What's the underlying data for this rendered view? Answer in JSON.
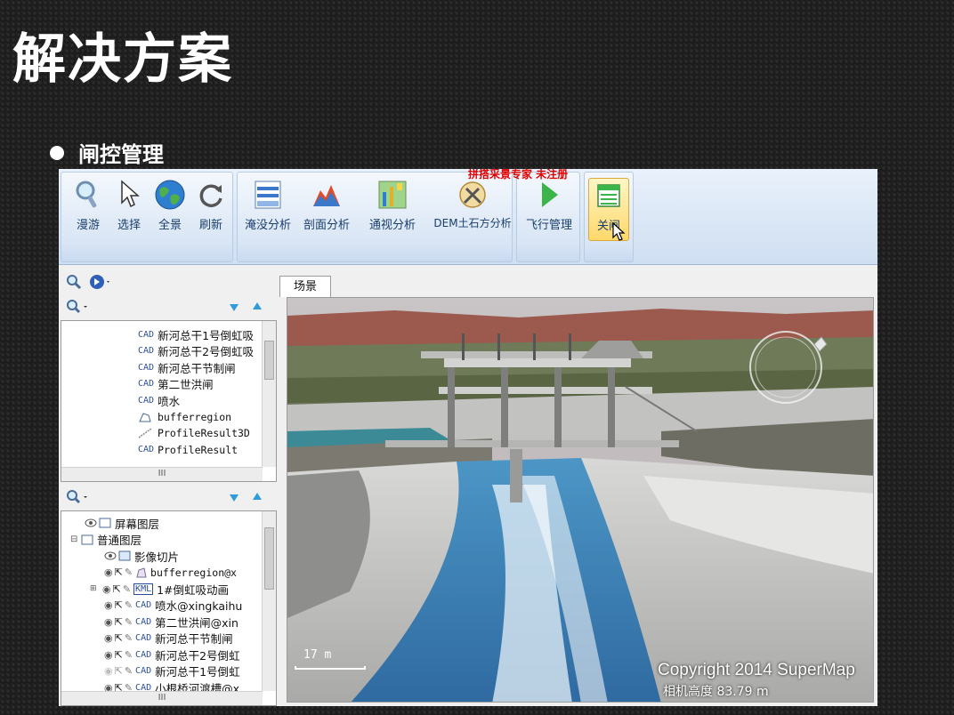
{
  "slide": {
    "title": "解决方案",
    "bullet": "闸控管理"
  },
  "ribbon": {
    "watermark": "拼搭采景专家 未注册",
    "buttons": {
      "roam": "漫游",
      "select": "选择",
      "full_extent": "全景",
      "refresh": "刷新",
      "flood": "淹没分析",
      "profile": "剖面分析",
      "sight": "通视分析",
      "dem_earthwork": "DEM土石方分析",
      "flight": "飞行管理",
      "close_gate": "关闸"
    }
  },
  "layer_tree": {
    "items": [
      {
        "type": "CAD",
        "label": "新河总干1号倒虹吸"
      },
      {
        "type": "CAD",
        "label": "新河总干2号倒虹吸"
      },
      {
        "type": "CAD",
        "label": "新河总干节制闸"
      },
      {
        "type": "CAD",
        "label": "第二世洪闸"
      },
      {
        "type": "CAD",
        "label": "喷水"
      },
      {
        "type": "region",
        "label": "bufferregion"
      },
      {
        "type": "line",
        "label": "ProfileResult3D"
      },
      {
        "type": "CAD",
        "label": "ProfileResult"
      }
    ],
    "hscroll": "III"
  },
  "scene_layers": {
    "screen_layers": "屏幕图层",
    "normal_layers": "普通图层",
    "image_tiles": "影像切片",
    "items": [
      {
        "type": "region",
        "label": "bufferregion@x"
      },
      {
        "type": "KML",
        "label": "1#倒虹吸动画"
      },
      {
        "type": "CAD",
        "label": "喷水@xingkaihu"
      },
      {
        "type": "CAD",
        "label": "第二世洪闸@xin"
      },
      {
        "type": "CAD",
        "label": "新河总干节制闸"
      },
      {
        "type": "CAD",
        "label": "新河总干2号倒虹"
      },
      {
        "type": "CAD",
        "label": "新河总干1号倒虹"
      },
      {
        "type": "CAD",
        "label": "小根桥河渡槽@x"
      }
    ],
    "hscroll": "III"
  },
  "scene": {
    "tab": "场景",
    "scale_text": "17 m",
    "copyright": "Copyright 2014 SuperMap",
    "altitude": "相机高度 83.79 m"
  },
  "colors": {
    "ribbon_text": "#1a3e6c",
    "cad_text": "#2a4f9a",
    "watermark": "#e00000"
  }
}
